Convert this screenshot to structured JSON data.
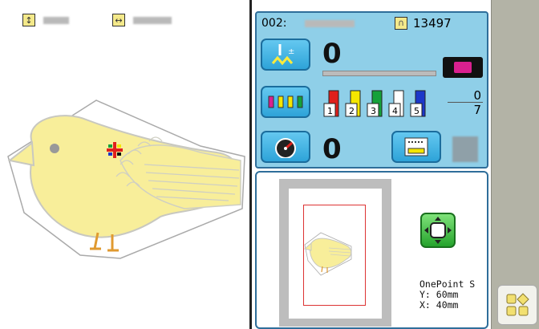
{
  "canvas": {
    "height_label": "redacted",
    "width_label": "redacted"
  },
  "status": {
    "pattern_number": "002:",
    "stitch_count": "13497",
    "stitch_progress_value": "0",
    "color_change_current": "0",
    "color_change_total": "7",
    "thread_numbers": [
      "1",
      "2",
      "3",
      "4",
      "5"
    ],
    "thread_colors": [
      "#e0201c",
      "#f5e600",
      "#15a13a",
      "#ffffff",
      "#1c37c9"
    ],
    "speed_value": "0"
  },
  "preview": {
    "name": "OnePoint S",
    "y_label": "Y:  60mm",
    "x_label": "X:  40mm"
  }
}
